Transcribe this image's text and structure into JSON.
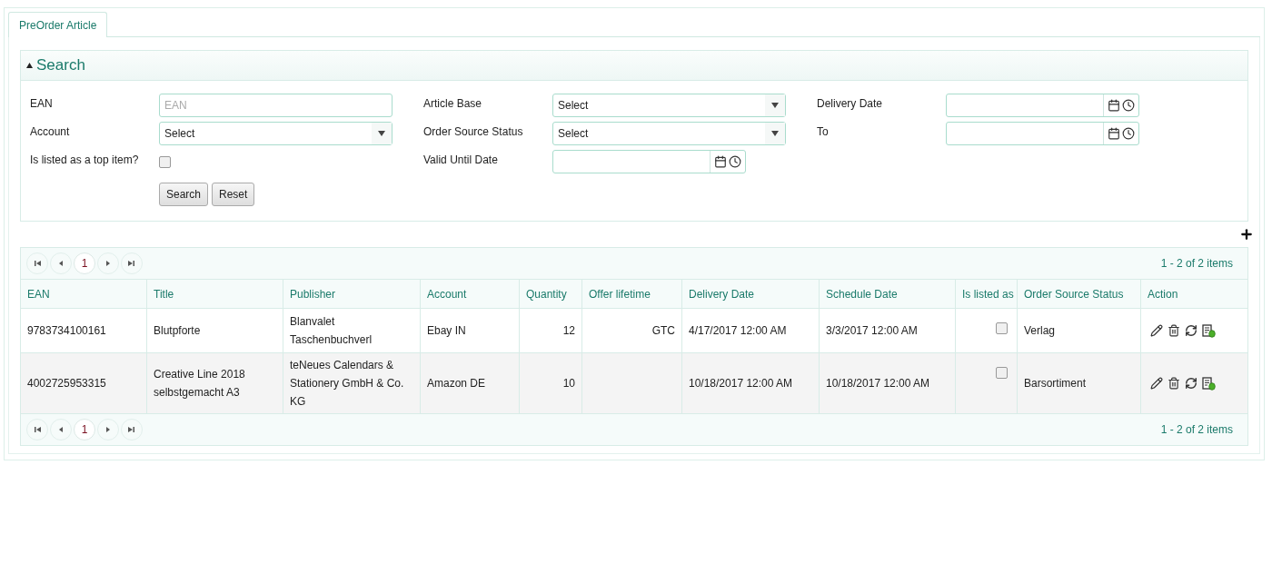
{
  "tab": {
    "label": "PreOrder Article",
    "selected": true
  },
  "search": {
    "title": "Search",
    "expanded": true,
    "columns": [
      [
        {
          "kind": "text",
          "label": "EAN",
          "placeholder": "EAN"
        },
        {
          "kind": "select",
          "label": "Account",
          "value": "Select"
        },
        {
          "kind": "checkbox",
          "label": "Is listed as a top item?",
          "checked": false
        }
      ],
      [
        {
          "kind": "select",
          "label": "Article Base",
          "value": "Select"
        },
        {
          "kind": "select",
          "label": "Order Source Status",
          "value": "Select"
        },
        {
          "kind": "datetime",
          "label": "Valid Until Date"
        }
      ],
      [
        {
          "kind": "datetime",
          "label": "Delivery Date"
        },
        {
          "kind": "datetime",
          "label": "To"
        }
      ]
    ],
    "buttons": [
      "Search",
      "Reset"
    ]
  },
  "pager_top": {
    "pages": [
      {
        "label": "1",
        "selected": true
      }
    ],
    "summary": "1 - 2 of 2 items"
  },
  "table": {
    "columns": [
      "EAN",
      "Title",
      "Publisher",
      "Account",
      "Quantity",
      "Offer lifetime",
      "Delivery Date",
      "Schedule Date",
      "Is listed as",
      "Order Source Status",
      "Action"
    ],
    "rows": [
      {
        "ean": "9783734100161",
        "title": "Blutpforte",
        "publisher": "Blanvalet Taschenbuchverl",
        "account": "Ebay IN",
        "quantity": "12",
        "offer_lifetime": "GTC",
        "delivery_date": "4/17/2017 12:00 AM",
        "schedule_date": "3/3/2017 12:00 AM",
        "listed": false,
        "order_source_status": "Verlag"
      },
      {
        "ean": "4002725953315",
        "title": "Creative Line 2018 selbstgemacht A3",
        "publisher": "teNeues Calendars & Stationery GmbH & Co. KG",
        "account": "Amazon DE",
        "quantity": "10",
        "delivery_date": "10/18/2017 12:00 AM",
        "schedule_date": "10/18/2017 12:00 AM",
        "listed": false,
        "order_source_status": "Barsortiment"
      }
    ]
  },
  "pager_bottom": {
    "pages": [
      {
        "label": "1",
        "selected": true
      }
    ],
    "summary": "1 - 2 of 2 items"
  }
}
